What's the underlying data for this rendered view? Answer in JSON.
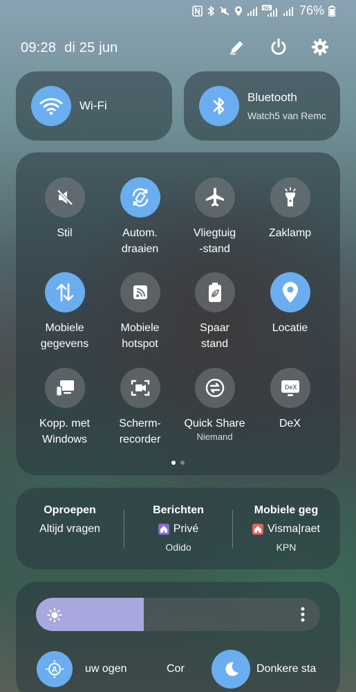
{
  "status": {
    "battery": "76%"
  },
  "header": {
    "time": "09:28",
    "date": "di 25 jun",
    "actions": [
      "edit-icon",
      "power-icon",
      "settings-icon"
    ]
  },
  "connectivity": {
    "wifi": {
      "label": "Wi-Fi"
    },
    "bluetooth": {
      "label": "Bluetooth",
      "device": "Watch5 van Remc"
    }
  },
  "quick_settings": [
    {
      "id": "stil",
      "label": "Stil",
      "icon": "mute-icon",
      "active": false
    },
    {
      "id": "rotate",
      "label": "Autom.\ndraaien",
      "icon": "auto-rotate-icon",
      "active": true
    },
    {
      "id": "airplane",
      "label": "Vliegtuig\n-stand",
      "icon": "airplane-icon",
      "active": false
    },
    {
      "id": "flashlight",
      "label": "Zaklamp",
      "icon": "flashlight-icon",
      "active": false
    },
    {
      "id": "mobile-data",
      "label": "Mobiele\ngegevens",
      "icon": "mobile-data-icon",
      "active": true
    },
    {
      "id": "hotspot",
      "label": "Mobiele\nhotspot",
      "icon": "hotspot-icon",
      "active": false
    },
    {
      "id": "power-saving",
      "label": "Spaar\nstand",
      "icon": "battery-saver-icon",
      "active": false
    },
    {
      "id": "location",
      "label": "Locatie",
      "icon": "location-icon",
      "active": true
    },
    {
      "id": "link-windows",
      "label": "Kopp. met\nWindows",
      "icon": "link-windows-icon",
      "active": false
    },
    {
      "id": "screen-recorder",
      "label": "Scherm-\nrecorder",
      "icon": "screen-recorder-icon",
      "active": false
    },
    {
      "id": "quick-share",
      "label": "Quick Share",
      "sub": "Niemand",
      "icon": "quick-share-icon",
      "active": false
    },
    {
      "id": "dex",
      "label": "DeX",
      "icon": "dex-icon",
      "active": false
    }
  ],
  "pager": {
    "pages": 2,
    "current": 1
  },
  "sim": {
    "calls": {
      "title": "Oproepen",
      "value": "Altijd vragen"
    },
    "messages": {
      "title": "Berichten",
      "value": "Privé",
      "carrier": "Odido",
      "badge_color": "#8e6ad0"
    },
    "mobile_data": {
      "title": "Mobiele geg",
      "value": "Visma|raet",
      "carrier": "KPN",
      "badge_color": "#e0645a"
    }
  },
  "brightness": {
    "level": 0.38
  },
  "bottom": {
    "eye_comfort": "uw ogen",
    "contrast": "Cor",
    "dark_mode": "Donkere sta"
  },
  "colors": {
    "accent": "#6aaef0",
    "slider_fill": "#a9a8de"
  }
}
